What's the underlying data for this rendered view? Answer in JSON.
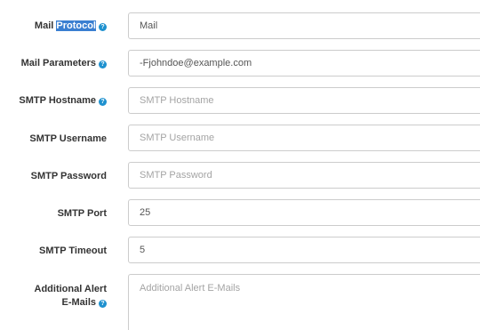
{
  "fields": {
    "mail_protocol": {
      "label_plain": "Mail ",
      "label_highlight": "Protocol",
      "value": "Mail"
    },
    "mail_parameters": {
      "label": "Mail Parameters",
      "value": "-Fjohndoe@example.com"
    },
    "smtp_hostname": {
      "label": "SMTP Hostname",
      "placeholder": "SMTP Hostname"
    },
    "smtp_username": {
      "label": "SMTP Username",
      "placeholder": "SMTP Username"
    },
    "smtp_password": {
      "label": "SMTP Password",
      "placeholder": "SMTP Password"
    },
    "smtp_port": {
      "label": "SMTP Port",
      "value": "25"
    },
    "smtp_timeout": {
      "label": "SMTP Timeout",
      "value": "5"
    },
    "additional_alert_emails": {
      "label_line1": "Additional Alert",
      "label_line2": "E-Mails",
      "placeholder": "Additional Alert E-Mails"
    }
  },
  "help_icon_glyph": "?",
  "colors": {
    "help_icon": "#1e91cf",
    "selection_highlight": "#3a7fd1"
  }
}
